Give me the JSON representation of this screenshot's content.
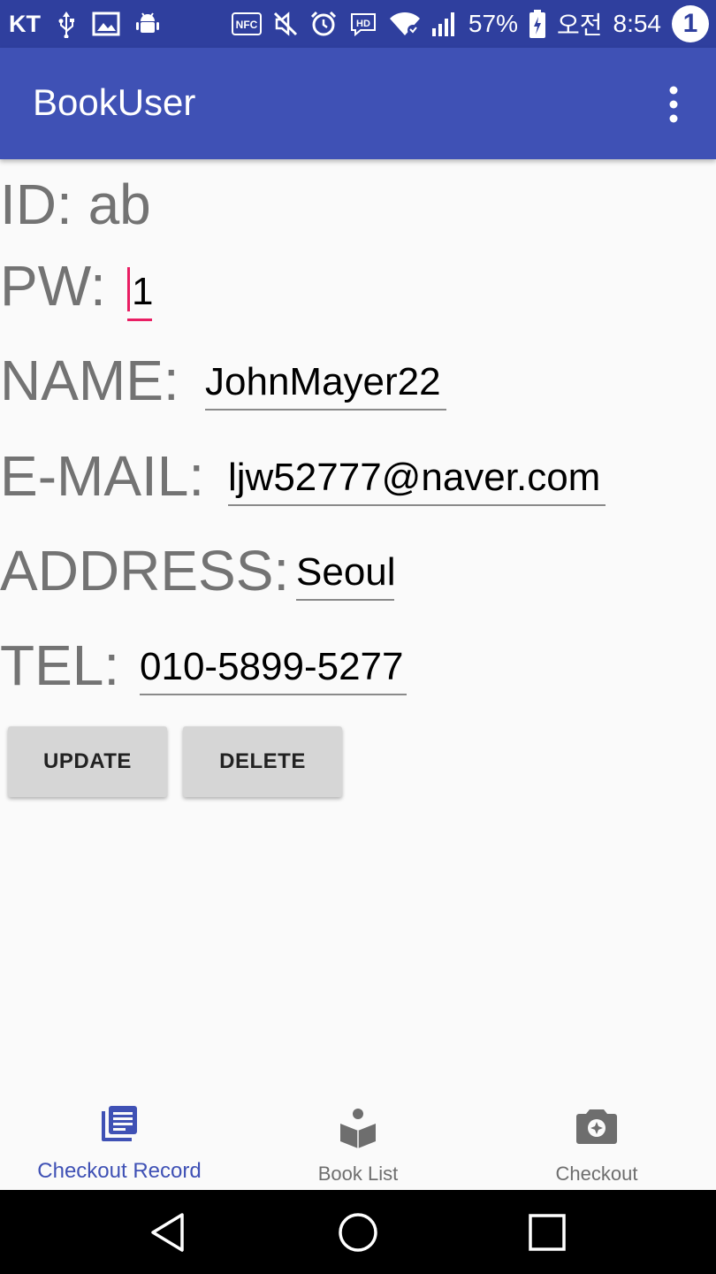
{
  "status_bar": {
    "carrier": "KT",
    "battery": "57%",
    "ampm": "오전",
    "time": "8:54",
    "notification_count": "1",
    "icons": [
      "usb-icon",
      "gallery-icon",
      "android-debug-icon",
      "nfc-icon",
      "mute-icon",
      "alarm-icon",
      "hd-icon",
      "wifi-icon",
      "signal-icon",
      "battery-icon"
    ]
  },
  "app_bar": {
    "title": "BookUser",
    "menu_icon": "more-vert-icon"
  },
  "form": {
    "id_label": "ID: ab",
    "pw_label": "PW:",
    "pw_value": "1",
    "name_label": "NAME:",
    "name_value": "JohnMayer22",
    "email_label": "E-MAIL:",
    "email_value": "ljw52777@naver.com",
    "address_label": "ADDRESS:",
    "address_value": "Seoul",
    "tel_label": "TEL:",
    "tel_value": "010-5899-5277"
  },
  "buttons": {
    "update": "UPDATE",
    "delete": "DELETE"
  },
  "bottom_nav": {
    "items": [
      {
        "label": "Checkout Record",
        "icon": "library-books-icon",
        "active": true
      },
      {
        "label": "Book List",
        "icon": "book-reader-icon",
        "active": false
      },
      {
        "label": "Checkout",
        "icon": "camera-icon",
        "active": false
      }
    ]
  },
  "colors": {
    "status_bar": "#2f3f9e",
    "app_bar": "#3f51b5",
    "accent": "#e91e63",
    "active_nav": "#3f51b5"
  }
}
